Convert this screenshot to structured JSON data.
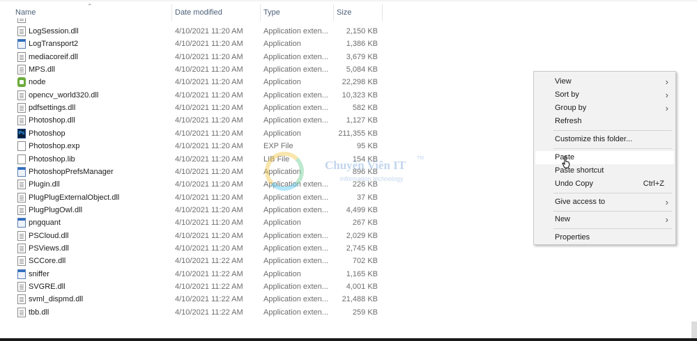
{
  "headers": {
    "name": "Name",
    "date": "Date modified",
    "type": "Type",
    "size": "Size"
  },
  "files": [
    {
      "name": "LogSession.dll",
      "date": "4/10/2021 11:20 AM",
      "type": "Application exten...",
      "size": "2,150 KB",
      "icon": "dll-file-icon"
    },
    {
      "name": "LogTransport2",
      "date": "4/10/2021 11:20 AM",
      "type": "Application",
      "size": "1,386 KB",
      "icon": "application-icon"
    },
    {
      "name": "mediacoreif.dll",
      "date": "4/10/2021 11:20 AM",
      "type": "Application exten...",
      "size": "3,679 KB",
      "icon": "dll-file-icon"
    },
    {
      "name": "MPS.dll",
      "date": "4/10/2021 11:20 AM",
      "type": "Application exten...",
      "size": "5,084 KB",
      "icon": "dll-file-icon"
    },
    {
      "name": "node",
      "date": "4/10/2021 11:20 AM",
      "type": "Application",
      "size": "22,298 KB",
      "icon": "nodejs-icon"
    },
    {
      "name": "opencv_world320.dll",
      "date": "4/10/2021 11:20 AM",
      "type": "Application exten...",
      "size": "10,323 KB",
      "icon": "dll-file-icon"
    },
    {
      "name": "pdfsettings.dll",
      "date": "4/10/2021 11:20 AM",
      "type": "Application exten...",
      "size": "582 KB",
      "icon": "dll-file-icon"
    },
    {
      "name": "Photoshop.dll",
      "date": "4/10/2021 11:20 AM",
      "type": "Application exten...",
      "size": "1,127 KB",
      "icon": "dll-file-icon"
    },
    {
      "name": "Photoshop",
      "date": "4/10/2021 11:20 AM",
      "type": "Application",
      "size": "211,355 KB",
      "icon": "photoshop-icon"
    },
    {
      "name": "Photoshop.exp",
      "date": "4/10/2021 11:20 AM",
      "type": "EXP File",
      "size": "95 KB",
      "icon": "document-icon"
    },
    {
      "name": "Photoshop.lib",
      "date": "4/10/2021 11:20 AM",
      "type": "LIB File",
      "size": "154 KB",
      "icon": "document-icon"
    },
    {
      "name": "PhotoshopPrefsManager",
      "date": "4/10/2021 11:20 AM",
      "type": "Application",
      "size": "896 KB",
      "icon": "application-icon"
    },
    {
      "name": "Plugin.dll",
      "date": "4/10/2021 11:20 AM",
      "type": "Application exten...",
      "size": "226 KB",
      "icon": "dll-file-icon"
    },
    {
      "name": "PlugPlugExternalObject.dll",
      "date": "4/10/2021 11:20 AM",
      "type": "Application exten...",
      "size": "37 KB",
      "icon": "dll-file-icon"
    },
    {
      "name": "PlugPlugOwl.dll",
      "date": "4/10/2021 11:20 AM",
      "type": "Application exten...",
      "size": "4,499 KB",
      "icon": "dll-file-icon"
    },
    {
      "name": "pngquant",
      "date": "4/10/2021 11:20 AM",
      "type": "Application",
      "size": "267 KB",
      "icon": "application-icon"
    },
    {
      "name": "PSCloud.dll",
      "date": "4/10/2021 11:20 AM",
      "type": "Application exten...",
      "size": "2,029 KB",
      "icon": "dll-file-icon"
    },
    {
      "name": "PSViews.dll",
      "date": "4/10/2021 11:20 AM",
      "type": "Application exten...",
      "size": "2,745 KB",
      "icon": "dll-file-icon"
    },
    {
      "name": "SCCore.dll",
      "date": "4/10/2021 11:22 AM",
      "type": "Application exten...",
      "size": "702 KB",
      "icon": "dll-file-icon"
    },
    {
      "name": "sniffer",
      "date": "4/10/2021 11:22 AM",
      "type": "Application",
      "size": "1,165 KB",
      "icon": "application-icon"
    },
    {
      "name": "SVGRE.dll",
      "date": "4/10/2021 11:22 AM",
      "type": "Application exten...",
      "size": "4,001 KB",
      "icon": "dll-file-icon"
    },
    {
      "name": "svml_dispmd.dll",
      "date": "4/10/2021 11:22 AM",
      "type": "Application exten...",
      "size": "21,488 KB",
      "icon": "dll-file-icon"
    },
    {
      "name": "tbb.dll",
      "date": "4/10/2021 11:22 AM",
      "type": "Application exten...",
      "size": "259 KB",
      "icon": "dll-file-icon"
    }
  ],
  "watermark": {
    "title": "Chuyên Viên IT",
    "subtitle": "information technology",
    "tm": "TM"
  },
  "context_menu": {
    "view": "View",
    "sort_by": "Sort by",
    "group_by": "Group by",
    "refresh": "Refresh",
    "customize": "Customize this folder...",
    "paste": "Paste",
    "paste_shortcut": "Paste shortcut",
    "undo_copy": "Undo Copy",
    "undo_shortcut": "Ctrl+Z",
    "give_access": "Give access to",
    "new": "New",
    "properties": "Properties",
    "submenu_arrow": "›"
  }
}
